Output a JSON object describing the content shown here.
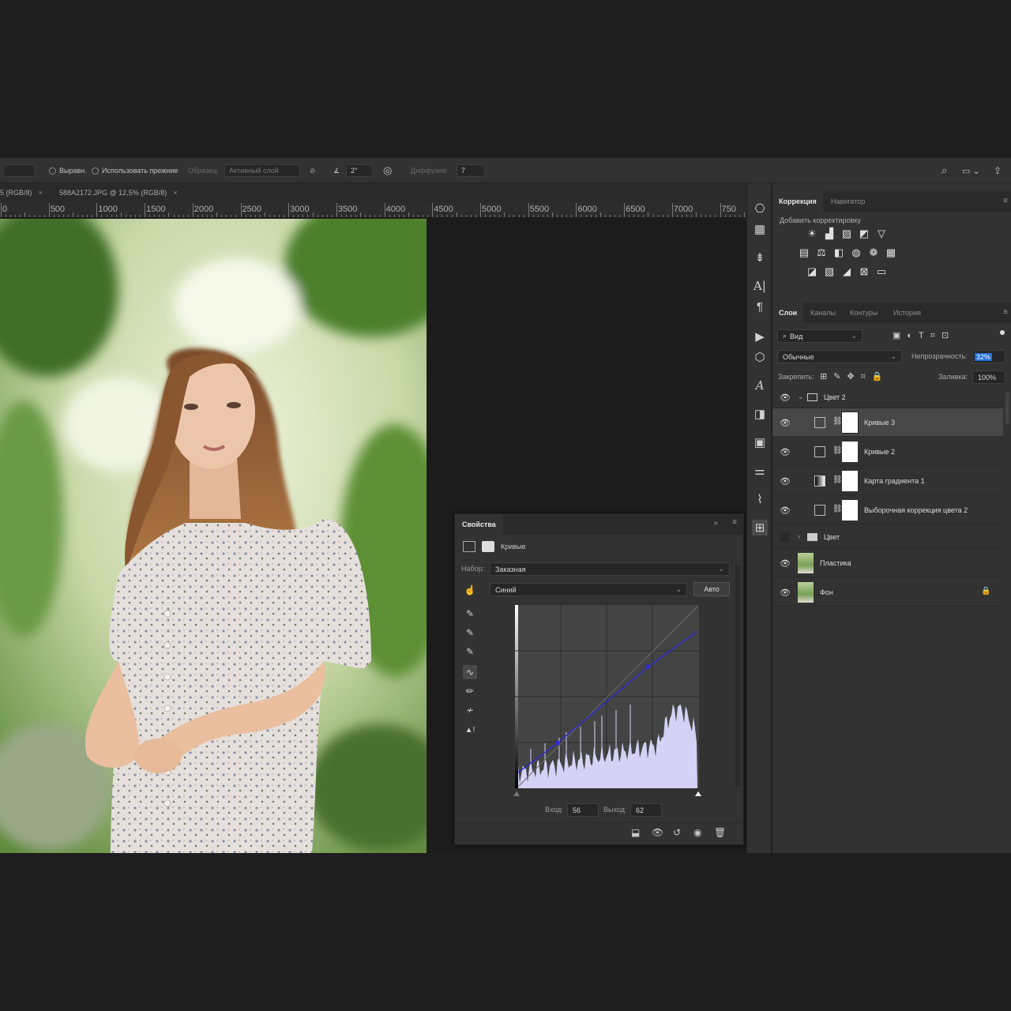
{
  "options_bar": {
    "align_label": "Выравн.",
    "use_legacy_label": "Использовать прежние",
    "sample_label": "Образец:",
    "sample_value": "Активный слой",
    "angle_value": "2°",
    "diffusion_label": "Диффузия:",
    "diffusion_value": "7"
  },
  "doc_tabs": [
    {
      "label": "5 (RGB/8)",
      "close": "×"
    },
    {
      "label": "588A2172.JPG @ 12,5% (RGB/8)",
      "close": "×"
    }
  ],
  "ruler": [
    "0",
    "500",
    "1000",
    "1500",
    "2000",
    "2500",
    "3000",
    "3500",
    "4000",
    "4500",
    "5000",
    "5500",
    "6000",
    "6500",
    "7000",
    "750"
  ],
  "correction_panel": {
    "tabs": [
      "Коррекция",
      "Навигатор"
    ],
    "add_label": "Добавить корректировку",
    "rows": [
      [
        "sun",
        "levels",
        "curves",
        "exposure",
        "triangle"
      ],
      [
        "vibrance",
        "balance",
        "bw",
        "photo-filter",
        "mixer",
        "grid"
      ],
      [
        "invert",
        "posterize",
        "threshold",
        "selective",
        "gradient-map"
      ]
    ]
  },
  "layers_panel": {
    "tabs": [
      "Слои",
      "Каналы",
      "Контуры",
      "История"
    ],
    "filter_label": "Вид",
    "blend_mode": "Обычные",
    "opacity_label": "Непрозрачность:",
    "opacity_value": "32%",
    "lock_label": "Закрепить:",
    "fill_label": "Заливка:",
    "fill_value": "100%",
    "layers": [
      {
        "name": "Цвет 2",
        "type": "group",
        "expanded": true,
        "visible": true
      },
      {
        "name": "Кривые 3",
        "type": "curves",
        "selected": true,
        "visible": true
      },
      {
        "name": "Кривые 2",
        "type": "curves",
        "visible": true
      },
      {
        "name": "Карта градиента 1",
        "type": "gradient-map",
        "visible": true
      },
      {
        "name": "Выборочная коррекция цвета 2",
        "type": "selective-color",
        "visible": true
      },
      {
        "name": "Цвет",
        "type": "group",
        "expanded": false,
        "visible": false
      },
      {
        "name": "Пластика",
        "type": "image",
        "visible": true
      },
      {
        "name": "Фон",
        "type": "image",
        "visible": true,
        "locked": true
      }
    ]
  },
  "properties_panel": {
    "title": "Свойства",
    "adjustment_name": "Кривые",
    "preset_label": "Набор:",
    "preset_value": "Заказная",
    "channel_value": "Синий",
    "auto_label": "Авто",
    "input_label": "Вход:",
    "input_value": "56",
    "output_label": "Выход:",
    "output_value": "62",
    "curve_color": "#2b2bd6",
    "histogram_color": "#d6d2f6"
  }
}
